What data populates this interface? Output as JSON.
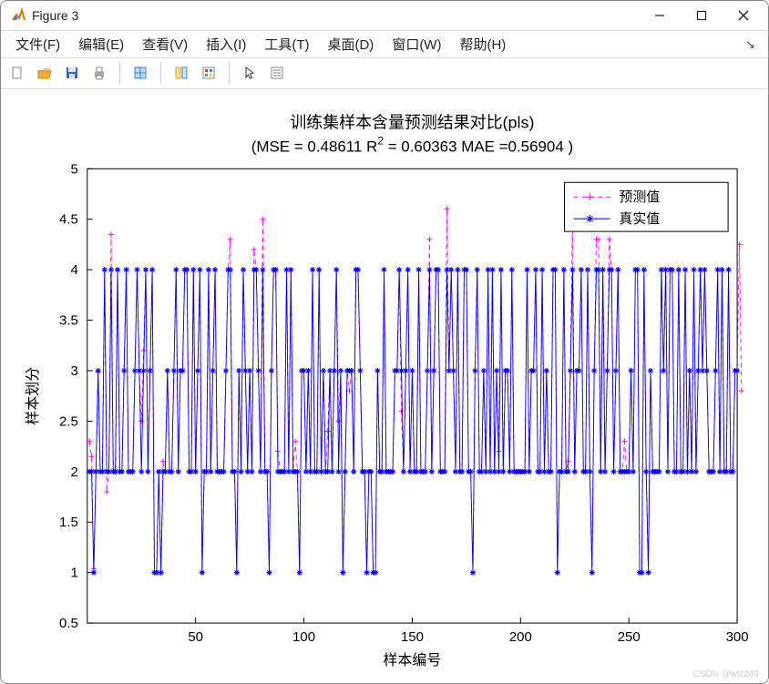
{
  "window": {
    "title": "Figure 3",
    "min_tip": "Minimize",
    "max_tip": "Maximize",
    "close_tip": "Close"
  },
  "menubar": {
    "items": [
      "文件(F)",
      "编辑(E)",
      "查看(V)",
      "插入(I)",
      "工具(T)",
      "桌面(D)",
      "窗口(W)",
      "帮助(H)"
    ]
  },
  "toolbar": {
    "items": [
      {
        "name": "new-icon"
      },
      {
        "name": "open-icon"
      },
      {
        "name": "save-icon"
      },
      {
        "name": "print-icon"
      },
      {
        "sep": true
      },
      {
        "name": "data-cursor-icon"
      },
      {
        "sep": true
      },
      {
        "name": "pan-icon"
      },
      {
        "name": "color-legend-icon"
      },
      {
        "sep": true
      },
      {
        "name": "pointer-icon"
      },
      {
        "name": "properties-icon"
      }
    ]
  },
  "chart_data": {
    "type": "line",
    "title": "训练集样本含量预测结果对比(pls)",
    "subtitle_prefix": "(MSE = 0.48611 R",
    "subtitle_exp": "2",
    "subtitle_suffix": " = 0.60363 MAE =0.56904 )",
    "xlabel": "样本编号",
    "ylabel": "样本划分",
    "xlim": [
      0,
      300
    ],
    "ylim": [
      0.5,
      5
    ],
    "xticks": [
      50,
      100,
      150,
      200,
      250,
      300
    ],
    "yticks": [
      0.5,
      1,
      1.5,
      2,
      2.5,
      3,
      3.5,
      4,
      4.5,
      5
    ],
    "legend": {
      "pred": "预测值",
      "real": "真实值"
    },
    "series": [
      {
        "name": "预测值",
        "color": "#ff00ff",
        "style": "dash",
        "marker": "plus",
        "values": [
          2.3,
          2.15,
          1.04,
          2.01,
          2.99,
          2,
          2.01,
          4,
          1.8,
          2,
          4.35,
          2,
          2,
          4,
          2,
          2,
          3,
          4,
          2,
          2,
          2,
          3,
          4,
          3,
          2.5,
          3.2,
          4,
          2,
          3,
          4,
          1,
          1,
          2,
          1,
          2.1,
          2,
          3,
          2,
          2,
          3,
          4,
          2,
          3,
          3,
          4,
          4,
          2,
          2,
          4,
          2,
          3,
          4,
          1,
          2,
          2,
          4,
          2,
          3,
          4,
          2,
          2,
          2,
          2,
          3,
          4,
          4.3,
          2,
          2,
          1,
          3,
          2,
          4,
          3,
          2,
          3,
          2,
          4.2,
          4,
          3,
          2,
          4.5,
          2,
          2,
          1,
          3,
          4,
          4,
          2.2,
          2,
          2,
          2,
          4,
          2,
          4,
          2,
          2.3,
          2,
          1,
          3,
          3,
          2,
          3,
          2,
          4,
          2,
          2,
          4,
          2,
          3,
          2,
          2.4,
          3,
          2,
          3,
          4,
          2.5,
          3,
          1,
          2,
          3,
          2.8,
          3,
          2,
          4,
          4,
          3,
          2,
          2,
          1,
          2,
          2,
          1,
          1,
          3,
          2,
          2,
          4,
          2,
          2,
          2,
          2,
          3,
          3,
          4,
          2.6,
          2,
          3,
          4,
          2,
          3,
          2,
          2,
          4,
          2,
          2,
          2,
          3,
          4.3,
          2,
          3,
          4,
          4,
          2,
          2,
          2,
          4.6,
          3,
          4,
          3,
          2,
          4,
          2,
          2,
          4,
          4,
          2,
          2,
          1,
          3,
          4,
          2,
          2,
          3,
          2,
          4,
          2,
          4,
          2,
          3,
          2.2,
          4,
          2,
          3,
          3,
          2,
          4,
          2,
          2,
          2,
          2,
          2,
          2,
          4,
          2,
          3,
          3,
          4,
          2,
          2,
          4,
          2,
          3,
          2,
          2,
          4,
          4,
          1,
          2,
          2,
          4,
          2,
          2.1,
          3,
          4.55,
          2,
          3,
          3,
          4,
          2,
          2,
          4,
          2,
          1,
          3,
          4.3,
          4.3,
          2,
          4,
          2,
          3,
          4.3,
          4,
          2,
          3,
          4,
          2,
          2,
          2.3,
          2,
          2,
          3,
          2,
          4,
          4,
          1,
          1,
          4,
          2,
          1,
          3,
          2,
          2,
          2,
          2,
          4,
          3,
          4,
          2,
          4,
          4,
          2,
          2,
          4,
          2,
          2,
          4,
          2,
          3,
          2,
          4,
          2,
          3,
          4,
          3,
          4,
          3,
          2,
          2,
          2,
          3,
          4,
          2,
          4,
          2,
          2,
          4,
          2,
          2,
          3,
          3,
          4.25,
          2.8
        ]
      },
      {
        "name": "真实值",
        "color": "#0000ff",
        "style": "solid",
        "marker": "asterisk",
        "values": [
          2,
          2,
          1,
          2,
          3,
          2,
          2,
          4,
          2,
          2,
          4,
          2,
          2,
          4,
          2,
          2,
          3,
          4,
          2,
          2,
          2,
          3,
          4,
          3,
          2,
          3,
          4,
          2,
          3,
          4,
          1,
          1,
          2,
          1,
          2,
          2,
          3,
          2,
          2,
          3,
          4,
          2,
          3,
          3,
          4,
          4,
          2,
          2,
          4,
          2,
          3,
          4,
          1,
          2,
          2,
          4,
          2,
          3,
          4,
          2,
          2,
          2,
          2,
          3,
          4,
          4,
          2,
          2,
          1,
          3,
          2,
          4,
          3,
          2,
          3,
          2,
          4,
          4,
          3,
          2,
          4,
          2,
          2,
          1,
          3,
          4,
          4,
          2,
          2,
          2,
          2,
          4,
          2,
          4,
          2,
          2,
          2,
          1,
          3,
          3,
          2,
          3,
          2,
          4,
          2,
          2,
          4,
          2,
          3,
          2,
          2,
          3,
          2,
          3,
          4,
          2,
          3,
          1,
          2,
          3,
          3,
          3,
          2,
          4,
          4,
          3,
          2,
          2,
          1,
          2,
          2,
          1,
          1,
          3,
          2,
          2,
          4,
          2,
          2,
          2,
          2,
          3,
          3,
          4,
          3,
          2,
          3,
          4,
          2,
          3,
          2,
          2,
          4,
          2,
          2,
          2,
          3,
          4,
          2,
          3,
          4,
          4,
          2,
          2,
          2,
          4,
          3,
          4,
          3,
          2,
          4,
          2,
          2,
          4,
          4,
          2,
          2,
          1,
          3,
          4,
          2,
          2,
          3,
          2,
          4,
          2,
          4,
          2,
          3,
          2,
          4,
          2,
          3,
          3,
          2,
          4,
          2,
          2,
          2,
          2,
          2,
          2,
          4,
          2,
          3,
          3,
          4,
          2,
          2,
          4,
          2,
          3,
          2,
          2,
          4,
          4,
          1,
          2,
          2,
          4,
          2,
          2,
          3,
          4,
          2,
          3,
          3,
          4,
          2,
          2,
          4,
          2,
          1,
          3,
          4,
          4,
          2,
          4,
          2,
          3,
          4,
          4,
          2,
          3,
          4,
          2,
          2,
          2,
          2,
          2,
          3,
          2,
          4,
          4,
          1,
          1,
          4,
          2,
          1,
          3,
          2,
          2,
          2,
          2,
          4,
          3,
          4,
          2,
          4,
          4,
          2,
          2,
          4,
          2,
          2,
          4,
          2,
          3,
          2,
          4,
          2,
          3,
          4,
          3,
          4,
          3,
          2,
          2,
          2,
          3,
          4,
          2,
          4,
          2,
          2,
          4,
          2,
          2,
          3,
          3
        ]
      }
    ]
  },
  "watermark": "CSDN @wlz249"
}
